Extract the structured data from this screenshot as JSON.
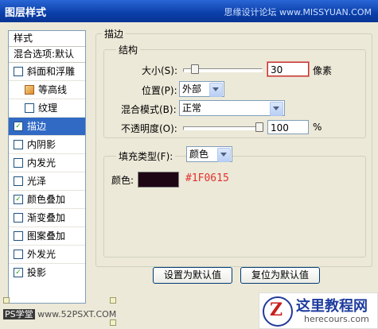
{
  "window": {
    "title": "图层样式",
    "watermark": "思缘设计论坛",
    "watermark_url": "www.MISSYUAN.COM"
  },
  "sidebar": {
    "header": "样式",
    "blend_options": "混合选项:默认",
    "items": [
      {
        "label": "斜面和浮雕",
        "checked": false
      },
      {
        "label": "等高线",
        "checked": false
      },
      {
        "label": "纹理",
        "checked": false
      },
      {
        "label": "描边",
        "checked": true,
        "active": true
      },
      {
        "label": "内阴影",
        "checked": false
      },
      {
        "label": "内发光",
        "checked": false
      },
      {
        "label": "光泽",
        "checked": false
      },
      {
        "label": "颜色叠加",
        "checked": true
      },
      {
        "label": "渐变叠加",
        "checked": false
      },
      {
        "label": "图案叠加",
        "checked": false
      },
      {
        "label": "外发光",
        "checked": false
      },
      {
        "label": "投影",
        "checked": true
      }
    ]
  },
  "stroke": {
    "section_title": "描边",
    "structure_title": "结构",
    "size_label": "大小(S):",
    "size_value": "30",
    "size_unit": "像素",
    "position_label": "位置(P):",
    "position_value": "外部",
    "blend_mode_label": "混合模式(B):",
    "blend_mode_value": "正常",
    "opacity_label": "不透明度(O):",
    "opacity_value": "100",
    "opacity_unit": "%",
    "fill_type_label": "填充类型(F):",
    "fill_type_value": "颜色",
    "color_label": "颜色:",
    "color_hex": "#1F0615",
    "swatch_color": "#1f0615"
  },
  "buttons": {
    "set_default": "设置为默认值",
    "reset_default": "复位为默认值"
  },
  "footer": {
    "ps_badge": "PS学堂",
    "site": "www.52PSXT.COM"
  },
  "logo": {
    "title": "这里教程网",
    "subtitle": "herecours.com"
  },
  "colors": {
    "accent": "#316ac5",
    "hex_text": "#e23131"
  }
}
